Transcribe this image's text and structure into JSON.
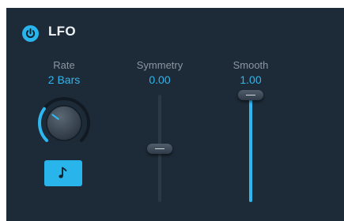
{
  "colors": {
    "panel_bg": "#1d2a37",
    "accent": "#2fb7f0",
    "label": "#8a97a3",
    "title": "#eef2f5"
  },
  "header": {
    "power_icon": "power-icon",
    "title": "LFO",
    "power_on": true
  },
  "rate": {
    "label": "Rate",
    "value": "2 Bars",
    "knob_level": 0.3,
    "sync_icon": "music-note-icon",
    "sync_on": true
  },
  "symmetry": {
    "label": "Symmetry",
    "value": "0.00",
    "level": 0.5
  },
  "smooth": {
    "label": "Smooth",
    "value": "1.00",
    "level": 1.0
  }
}
